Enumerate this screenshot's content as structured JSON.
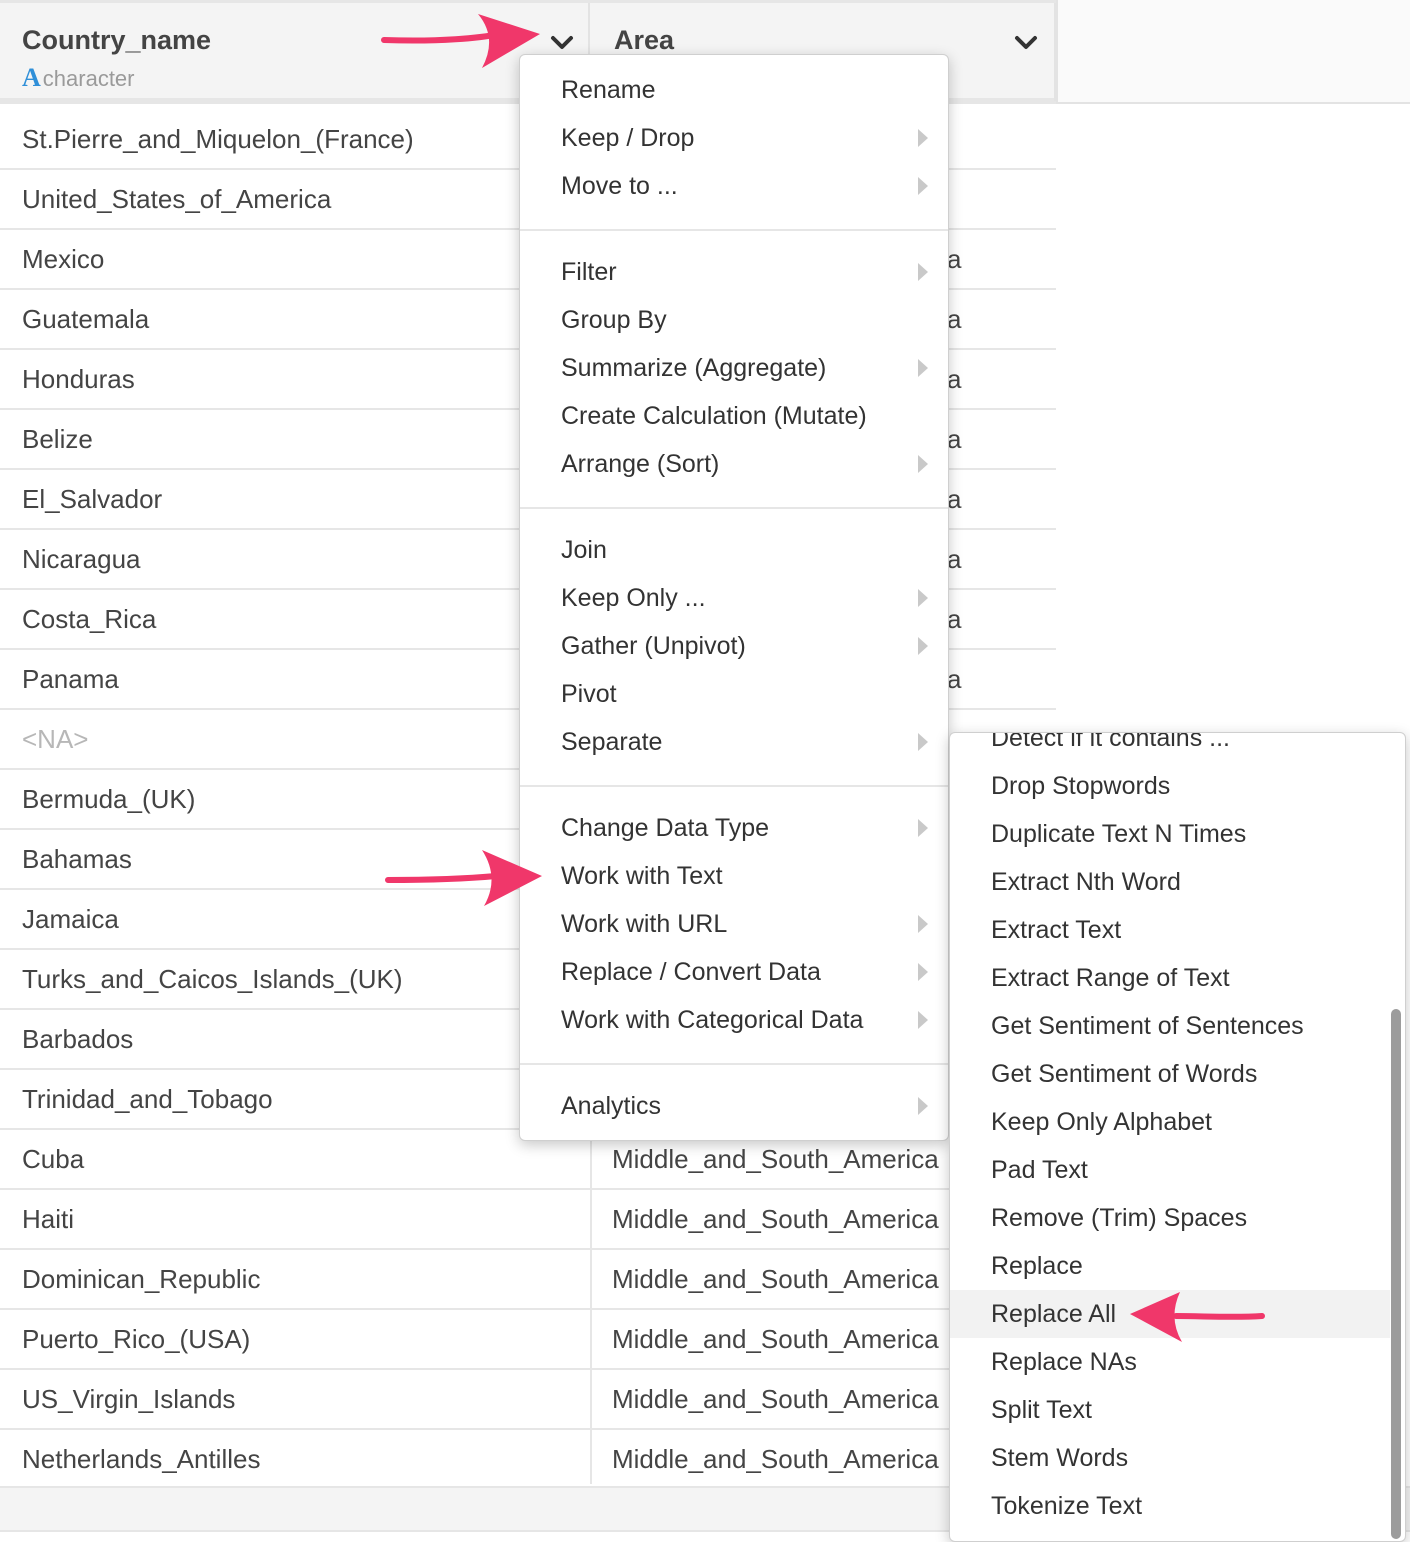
{
  "columns": [
    {
      "name": "Country_name",
      "type_letter": "A",
      "type_label": "character"
    },
    {
      "name": "Area"
    }
  ],
  "rows": [
    {
      "country": "St.Pierre_and_Miquelon_(France)",
      "area": ""
    },
    {
      "country": "United_States_of_America",
      "area": ""
    },
    {
      "country": "Mexico",
      "area": "a"
    },
    {
      "country": "Guatemala",
      "area": "a"
    },
    {
      "country": "Honduras",
      "area": "a"
    },
    {
      "country": "Belize",
      "area": "a"
    },
    {
      "country": "El_Salvador",
      "area": "a"
    },
    {
      "country": "Nicaragua",
      "area": "a"
    },
    {
      "country": "Costa_Rica",
      "area": "a"
    },
    {
      "country": "Panama",
      "area": "a"
    },
    {
      "country": "<NA>",
      "area": ""
    },
    {
      "country": "Bermuda_(UK)",
      "area": ""
    },
    {
      "country": "Bahamas",
      "area": ""
    },
    {
      "country": "Jamaica",
      "area": ""
    },
    {
      "country": "Turks_and_Caicos_Islands_(UK)",
      "area": ""
    },
    {
      "country": "Barbados",
      "area": ""
    },
    {
      "country": "Trinidad_and_Tobago",
      "area": ""
    },
    {
      "country": "Cuba",
      "area": "Middle_and_South_America"
    },
    {
      "country": "Haiti",
      "area": "Middle_and_South_America"
    },
    {
      "country": "Dominican_Republic",
      "area": "Middle_and_South_America"
    },
    {
      "country": "Puerto_Rico_(USA)",
      "area": "Middle_and_South_America"
    },
    {
      "country": "US_Virgin_Islands",
      "area": "Middle_and_South_America"
    },
    {
      "country": "Netherlands_Antilles",
      "area": "Middle_and_South_America"
    }
  ],
  "menu": {
    "rename": "Rename",
    "keep_drop": "Keep / Drop",
    "move_to": "Move to ...",
    "filter": "Filter",
    "group_by": "Group By",
    "summarize": "Summarize (Aggregate)",
    "create_calculation": "Create Calculation (Mutate)",
    "arrange": "Arrange (Sort)",
    "join": "Join",
    "keep_only": "Keep Only ...",
    "gather": "Gather (Unpivot)",
    "pivot": "Pivot",
    "separate": "Separate",
    "change_data_type": "Change Data Type",
    "work_with_text": "Work with Text",
    "work_with_url": "Work with URL",
    "replace_convert": "Replace / Convert Data",
    "work_with_categorical": "Work with Categorical Data",
    "analytics": "Analytics"
  },
  "submenu": {
    "items": [
      "Detect if it contains ...",
      "Drop Stopwords",
      "Duplicate Text N Times",
      "Extract Nth Word",
      "Extract Text",
      "Extract Range of Text",
      "Get Sentiment of Sentences",
      "Get Sentiment of Words",
      "Keep Only Alphabet",
      "Pad Text",
      "Remove (Trim) Spaces",
      "Replace",
      "Replace All",
      "Replace NAs",
      "Split Text",
      "Stem Words",
      "Tokenize Text"
    ],
    "highlighted": "Replace All"
  },
  "colors": {
    "annotation_arrow": "#f0376a",
    "type_letter": "#2f8fd8",
    "na_text": "#b7b7b7"
  }
}
